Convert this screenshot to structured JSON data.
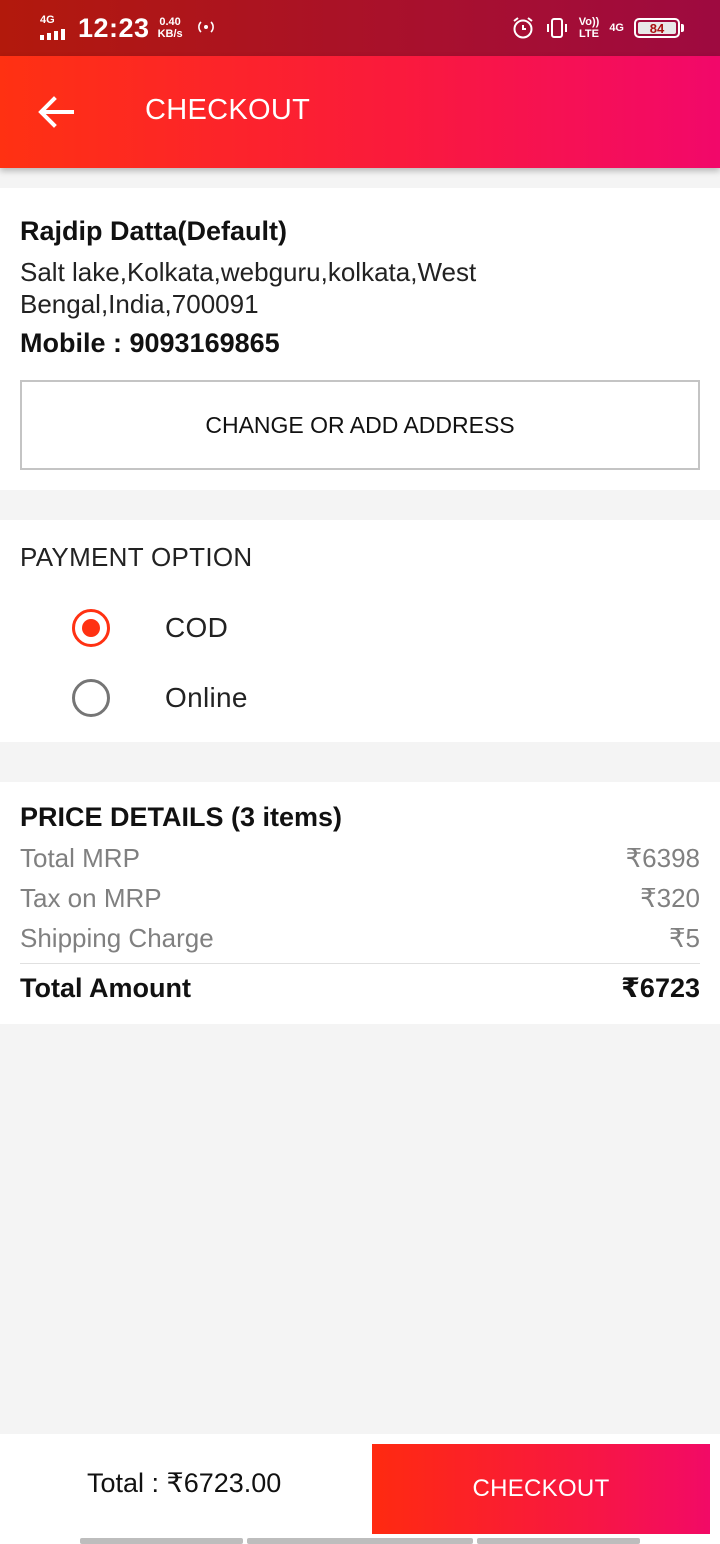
{
  "status_bar": {
    "network": "4G",
    "time": "12:23",
    "speed_value": "0.40",
    "speed_unit": "KB/s",
    "volte_top": "Vo))",
    "volte_bottom": "LTE",
    "network_right": "4G",
    "battery": "84"
  },
  "app_bar": {
    "title": "CHECKOUT"
  },
  "address": {
    "name": "Rajdip Datta(Default)",
    "line": "Salt lake,Kolkata,webguru,kolkata,West Bengal,India,700091",
    "mobile": "Mobile : 9093169865",
    "change_button": "CHANGE OR ADD ADDRESS"
  },
  "payment": {
    "title": "PAYMENT OPTION",
    "options": [
      {
        "label": "COD",
        "selected": true
      },
      {
        "label": "Online",
        "selected": false
      }
    ]
  },
  "price_details": {
    "title": "PRICE DETAILS (3 items)",
    "rows": [
      {
        "label": "Total MRP",
        "value": "₹6398"
      },
      {
        "label": "Tax on MRP",
        "value": "₹320"
      },
      {
        "label": "Shipping Charge",
        "value": "₹5"
      }
    ],
    "total_label": "Total Amount",
    "total_value": "₹6723"
  },
  "bottom_bar": {
    "total": "Total : ₹6723.00",
    "checkout_button": "CHECKOUT"
  },
  "colors": {
    "accent": "#ff3112",
    "accent_end": "#f2086a",
    "status_bar": "#a8102e"
  }
}
